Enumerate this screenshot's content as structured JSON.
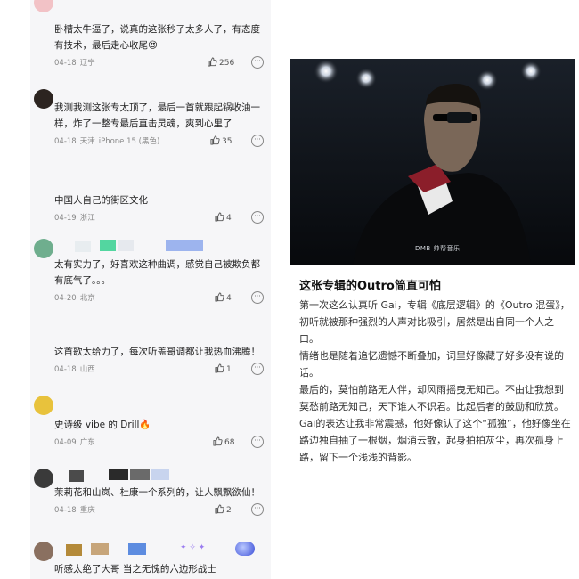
{
  "comments": [
    {
      "text": "卧槽太牛逼了，说真的这张秒了太多人了，有态度有技术，最后走心收尾😍",
      "date": "04-18",
      "location": "辽宁",
      "likes": "256"
    },
    {
      "text": "我测我测这张专太顶了，最后一首就跟起锅收油一样，炸了一整专最后直击灵魂，爽到心里了",
      "date": "04-18",
      "location": "天津",
      "device": "iPhone 15 (黑色)",
      "likes": "35"
    },
    {
      "text": "中国人自己的街区文化",
      "date": "04-19",
      "location": "浙江",
      "likes": "4"
    },
    {
      "text": "太有实力了，好喜欢这种曲调，感觉自己被欺负都有底气了。。。",
      "date": "04-20",
      "location": "北京",
      "likes": "4"
    },
    {
      "text": "这首歌太给力了，每次听盖哥调都让我热血沸腾！",
      "date": "04-18",
      "location": "山西",
      "likes": "1"
    },
    {
      "text": "史诗级 vibe 的 Drill🔥",
      "date": "04-09",
      "location": "广东",
      "likes": "68"
    },
    {
      "text": "茉莉花和山岚、杜康一个系列的，让人飘飘欲仙！",
      "date": "04-18",
      "location": "重庆",
      "likes": "2"
    },
    {
      "text": "听感太绝了大哥 当之无愧的六边形战士"
    }
  ],
  "post": {
    "title": "这张专辑的Outro简直可怕",
    "paragraphs": [
      "第一次这么认真听 Gai，专辑《底层逻辑》的《Outro 混蛋》，初听就被那种强烈的人声对比吸引，居然是出自同一个人之口。",
      "情绪也是随着追忆遗憾不断叠加，词里好像藏了好多没有说的话。",
      "最后的，莫怕前路无人伴，却风雨摇曳无知己。不由让我想到莫愁前路无知己，天下谁人不识君。比起后者的鼓励和欣赏。",
      "Gai的表达让我非常震撼，他好像认了这个“孤独”，他好像坐在路边独自抽了一根烟，烟消云散，起身拍拍灰尘，再次孤身上路，留下一个浅浅的背影。"
    ],
    "photo_watermark": "DMB 帅帮音乐"
  },
  "colors": {
    "page_bg": "#f6f6f8",
    "photo_bg": "#0e1217"
  }
}
